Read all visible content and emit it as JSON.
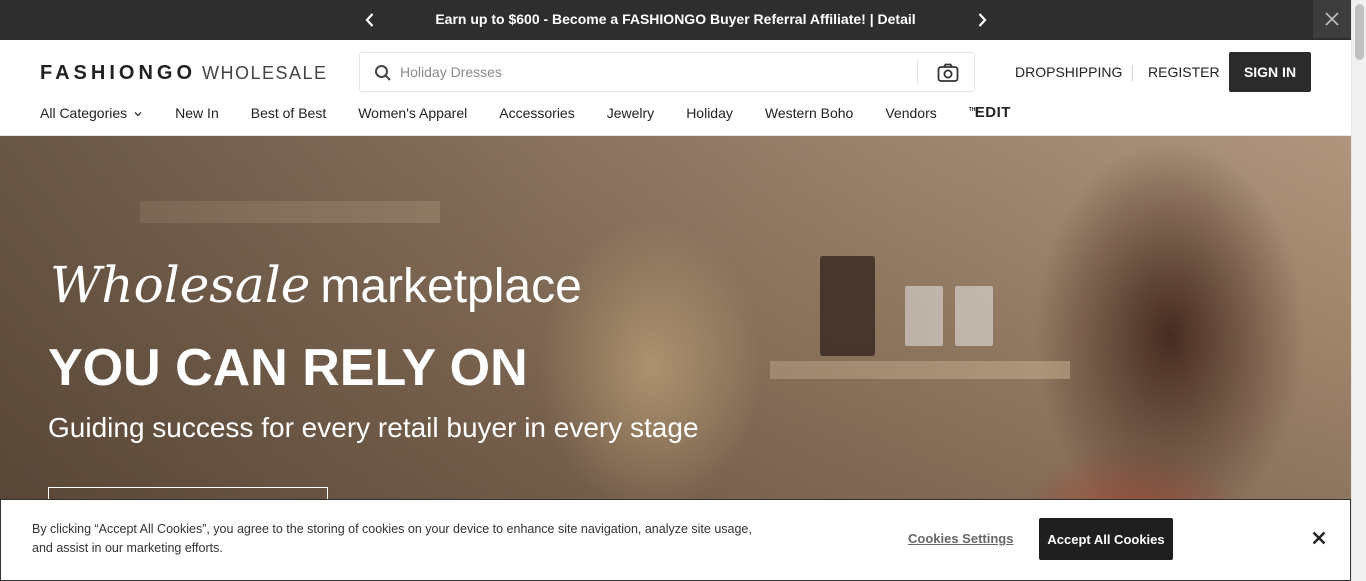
{
  "promo": {
    "text": "Earn up to $600 - Become a FASHIONGO Buyer Referral Affiliate! | Detail",
    "prev_icon": "chevron-left-icon",
    "next_icon": "chevron-right-icon",
    "close_icon": "close-icon"
  },
  "header": {
    "logo_main": "FASHIONGO",
    "logo_sub": "WHOLESALE",
    "search": {
      "placeholder": "Holiday Dresses",
      "value": "",
      "icon": "search-icon",
      "camera_icon": "camera-icon"
    },
    "links": {
      "dropshipping": "DROPSHIPPING",
      "register": "REGISTER",
      "sign_in": "SIGN IN"
    },
    "nav": [
      {
        "label": "All Categories"
      },
      {
        "label": "New In"
      },
      {
        "label": "Best of Best"
      },
      {
        "label": "Women's Apparel"
      },
      {
        "label": "Accessories"
      },
      {
        "label": "Jewelry"
      },
      {
        "label": "Holiday"
      },
      {
        "label": "Western Boho"
      },
      {
        "label": "Vendors"
      }
    ],
    "edit_logo": {
      "the": "THE",
      "word": "EDIT"
    }
  },
  "hero": {
    "italic": "Wholesale",
    "light": "marketplace",
    "headline": "YOU CAN RELY ON",
    "subheadline": "Guiding success for every retail buyer in every stage"
  },
  "cookie": {
    "text": "By clicking “Accept All Cookies”, you agree to the storing of cookies on your device to enhance site navigation, analyze site usage, and assist in our marketing efforts.",
    "settings_label": "Cookies Settings",
    "accept_label": "Accept All Cookies",
    "close_icon": "close-icon"
  },
  "colors": {
    "promo_bg": "#2e2e2e",
    "button_dark": "#2b2b2b",
    "accept_bg": "#1f1f1f"
  }
}
